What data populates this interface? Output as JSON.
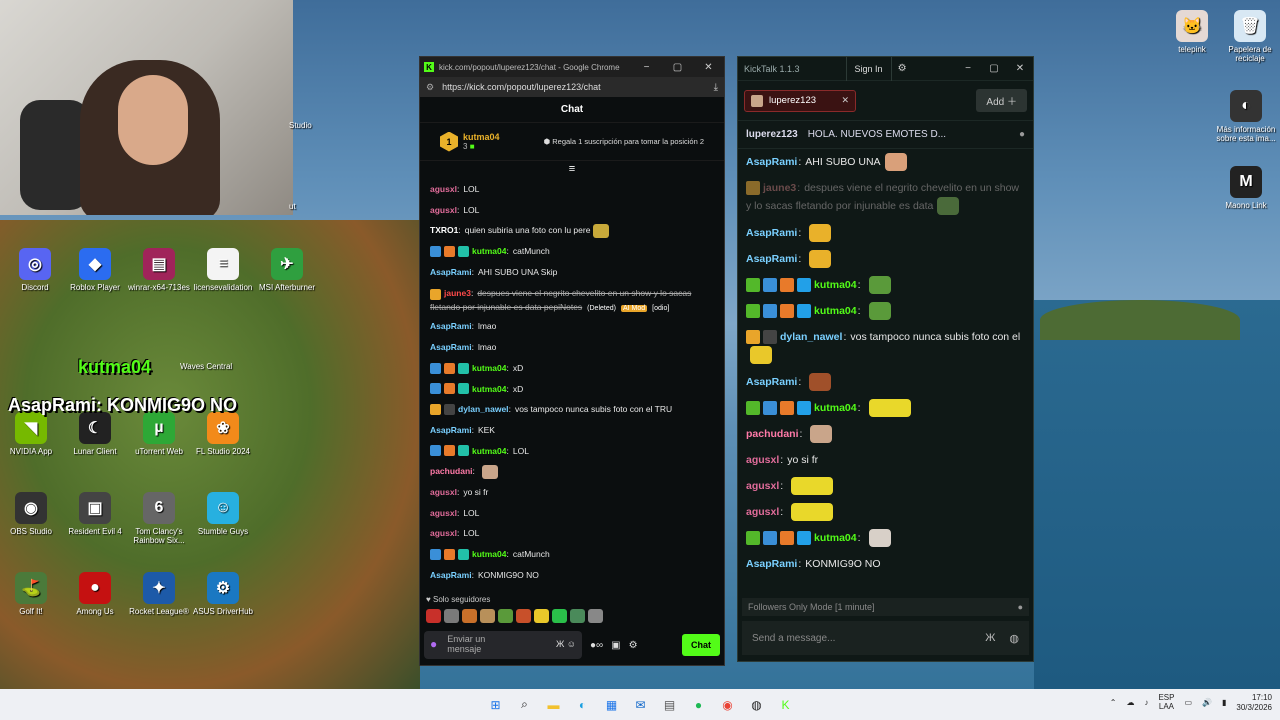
{
  "desktop": {
    "icons_left": [
      {
        "label": "Discord",
        "color": "#5865f2",
        "glyph": "◎"
      },
      {
        "label": "Roblox Player",
        "color": "#2b6cf0",
        "glyph": "◆"
      },
      {
        "label": "winrar-x64-713es",
        "color": "#a0245a",
        "glyph": "▤"
      },
      {
        "label": "licensevalidation",
        "color": "#f4f4f4",
        "glyph": "≡"
      },
      {
        "label": "MSI Afterburner",
        "color": "#2f9f3f",
        "glyph": "✈"
      },
      {
        "label": "NVIDIA App",
        "color": "#76b900",
        "glyph": "◥"
      },
      {
        "label": "Lunar Client",
        "color": "#222",
        "glyph": "☾"
      },
      {
        "label": "uTorrent Web",
        "color": "#2ea836",
        "glyph": "µ"
      },
      {
        "label": "FL Studio 2024",
        "color": "#f28a1a",
        "glyph": "❀"
      },
      {
        "label": "OBS Studio",
        "color": "#333",
        "glyph": "◉"
      },
      {
        "label": "Resident Evil 4",
        "color": "#444",
        "glyph": "▣"
      },
      {
        "label": "Tom Clancy's Rainbow Six...",
        "color": "#666",
        "glyph": "6"
      },
      {
        "label": "Stumble Guys",
        "color": "#27b0e0",
        "glyph": "☺"
      },
      {
        "label": "Golf It!",
        "color": "#4b7a3a",
        "glyph": "⛳"
      },
      {
        "label": "Among Us",
        "color": "#c51111",
        "glyph": "●"
      },
      {
        "label": "Rocket League®",
        "color": "#1d5aa8",
        "glyph": "✦"
      },
      {
        "label": "ASUS DriverHub",
        "color": "#1a78c2",
        "glyph": "⚙"
      }
    ],
    "partial_labels": {
      "studio": "Studio",
      "ut": "ut",
      "waves_central": "Waves Central"
    },
    "icons_right": [
      {
        "label": "telepink",
        "color": "#e5d9d4",
        "glyph": "🐱"
      },
      {
        "label": "Papelera de reciclaje",
        "color": "#d8e8f4",
        "glyph": "🗑"
      },
      {
        "label": "Más información sobre esta ima...",
        "color": "#333",
        "glyph": "◐"
      },
      {
        "label": "Maono Link",
        "color": "#222",
        "glyph": "M"
      }
    ]
  },
  "overlay": {
    "top_name": "kutma04",
    "bottom_user": "AsapRami",
    "bottom_msg": ": KONMIG9O NO"
  },
  "chrome": {
    "title": "kick.com/popout/luperez123/chat - Google Chrome",
    "url": "https://kick.com/popout/luperez123/chat",
    "chat_header": "Chat",
    "pinned": {
      "rank": "1",
      "user": "kutma04",
      "count": "3",
      "action": "Regala 1 suscripción para tomar la posición 2"
    },
    "messages": [
      {
        "badges": [],
        "user": "agusxl",
        "ucolor": "#e06c9a",
        "text": "LOL",
        "emote": ""
      },
      {
        "badges": [],
        "user": "agusxl",
        "ucolor": "#e06c9a",
        "text": "LOL",
        "emote": ""
      },
      {
        "badges": [],
        "user": "TXRO1",
        "ucolor": "#ffffff",
        "text": "quien subiria una foto con lu pere",
        "emote": "#c8a93a"
      },
      {
        "badges": [
          "#3a8fd8",
          "#e87a2a",
          "#22c0a8"
        ],
        "user": "kutma04",
        "ucolor": "#53fc18",
        "text": "catMunch",
        "emote": ""
      },
      {
        "badges": [],
        "user": "AsapRami",
        "ucolor": "#7ad0ff",
        "text": "AHI SUBO UNA Skip",
        "emote": ""
      },
      {
        "badges": [
          "#e9a52a"
        ],
        "user": "jaune3",
        "ucolor": "#ff4a4a",
        "text": "despues viene el negrito chevelito en un show y lo sacas fletando por injunable es data pepiNotes",
        "deleted": "(Deleted)",
        "aimod": "AI Mod",
        "odio": "[odio]",
        "tall": true
      },
      {
        "badges": [],
        "user": "AsapRami",
        "ucolor": "#7ad0ff",
        "text": "lmao",
        "emote": ""
      },
      {
        "badges": [],
        "user": "AsapRami",
        "ucolor": "#7ad0ff",
        "text": "lmao",
        "emote": ""
      },
      {
        "badges": [
          "#3a8fd8",
          "#e87a2a",
          "#22c0a8"
        ],
        "user": "kutma04",
        "ucolor": "#53fc18",
        "text": "xD",
        "emote": ""
      },
      {
        "badges": [
          "#3a8fd8",
          "#e87a2a",
          "#22c0a8"
        ],
        "user": "kutma04",
        "ucolor": "#53fc18",
        "text": "xD",
        "emote": ""
      },
      {
        "badges": [
          "#e9a52a",
          "#444"
        ],
        "user": "dylan_nawel",
        "ucolor": "#7ad0ff",
        "text": "vos tampoco nunca subis foto con el TRU",
        "emote": ""
      },
      {
        "badges": [],
        "user": "AsapRami",
        "ucolor": "#7ad0ff",
        "text": "KEK",
        "emote": ""
      },
      {
        "badges": [
          "#3a8fd8",
          "#e87a2a",
          "#22c0a8"
        ],
        "user": "kutma04",
        "ucolor": "#53fc18",
        "text": "LOL",
        "emote": ""
      },
      {
        "badges": [],
        "user": "pachudani",
        "ucolor": "#ff7aa8",
        "text": "",
        "emote": "#c9a58a"
      },
      {
        "badges": [],
        "user": "agusxl",
        "ucolor": "#e06c9a",
        "text": "yo si fr",
        "emote": ""
      },
      {
        "badges": [],
        "user": "agusxl",
        "ucolor": "#e06c9a",
        "text": "LOL",
        "emote": ""
      },
      {
        "badges": [],
        "user": "agusxl",
        "ucolor": "#e06c9a",
        "text": "LOL",
        "emote": ""
      },
      {
        "badges": [
          "#3a8fd8",
          "#e87a2a",
          "#22c0a8"
        ],
        "user": "kutma04",
        "ucolor": "#53fc18",
        "text": "catMunch",
        "emote": ""
      },
      {
        "badges": [],
        "user": "AsapRami",
        "ucolor": "#7ad0ff",
        "text": "KONMIG9O NO",
        "emote": ""
      }
    ],
    "followers_only": "Solo seguidores",
    "input_placeholder": "Enviar un mensaje",
    "send_label": "Chat"
  },
  "kicktalk": {
    "title": "KickTalk 1.1.3",
    "sign_in": "Sign In",
    "tab_label": "luperez123",
    "add_label": "Add",
    "pinned_user": "luperez123",
    "pinned_text": "HOLA. NUEVOS EMOTES D...",
    "messages": [
      {
        "badges": [],
        "user": "AsapRami",
        "ucolor": "#7ad0ff",
        "text": "AHI SUBO UNA",
        "emote": "#d9a07a"
      },
      {
        "badges": [
          "#8a6a2a"
        ],
        "user": "jaune3",
        "ucolor": "#6a4a4a",
        "text": "despues viene el negrito chevelito en un show y lo sacas fletando por injunable es data",
        "emote": "#4a6a3a",
        "tall": true,
        "dim": true
      },
      {
        "badges": [],
        "user": "AsapRami",
        "ucolor": "#7ad0ff",
        "text": "",
        "emote": "#e9b12a"
      },
      {
        "badges": [],
        "user": "AsapRami",
        "ucolor": "#7ad0ff",
        "text": "",
        "emote": "#e9b12a"
      },
      {
        "badges": [
          "#53b82a",
          "#3a8fd8",
          "#e87a2a",
          "#22a0e8"
        ],
        "user": "kutma04",
        "ucolor": "#53fc18",
        "text": "",
        "emote": "#5a9a3a"
      },
      {
        "badges": [
          "#53b82a",
          "#3a8fd8",
          "#e87a2a",
          "#22a0e8"
        ],
        "user": "kutma04",
        "ucolor": "#53fc18",
        "text": "",
        "emote": "#5a9a3a"
      },
      {
        "badges": [
          "#e9a52a",
          "#444"
        ],
        "user": "dylan_nawel",
        "ucolor": "#7ad0ff",
        "text": "vos tampoco nunca subis foto con el",
        "emote": "#e9c82a",
        "tall": true
      },
      {
        "badges": [],
        "user": "AsapRami",
        "ucolor": "#7ad0ff",
        "text": "",
        "emote": "#a0502a"
      },
      {
        "badges": [
          "#53b82a",
          "#3a8fd8",
          "#e87a2a",
          "#22a0e8"
        ],
        "user": "kutma04",
        "ucolor": "#53fc18",
        "text": "",
        "emote": "#e9d82a",
        "wide": true
      },
      {
        "badges": [],
        "user": "pachudani",
        "ucolor": "#ff7aa8",
        "text": "",
        "emote": "#c9a58a"
      },
      {
        "badges": [],
        "user": "agusxl",
        "ucolor": "#e06c9a",
        "text": "yo si fr",
        "emote": ""
      },
      {
        "badges": [],
        "user": "agusxl",
        "ucolor": "#e06c9a",
        "text": "",
        "emote": "#e9d82a",
        "wide": true
      },
      {
        "badges": [],
        "user": "agusxl",
        "ucolor": "#e06c9a",
        "text": "",
        "emote": "#e9d82a",
        "wide": true
      },
      {
        "badges": [
          "#53b82a",
          "#3a8fd8",
          "#e87a2a",
          "#22a0e8"
        ],
        "user": "kutma04",
        "ucolor": "#53fc18",
        "text": "",
        "emote": "#d8d0c8"
      },
      {
        "badges": [],
        "user": "AsapRami",
        "ucolor": "#7ad0ff",
        "text": "KONMIG9O NO",
        "emote": ""
      }
    ],
    "followers_mode": "Followers Only Mode [1 minute]",
    "input_placeholder": "Send a message..."
  },
  "taskbar": {
    "apps": [
      {
        "name": "start-button",
        "glyph": "⊞",
        "color": "#1a73e8"
      },
      {
        "name": "search-icon",
        "glyph": "⌕",
        "color": "#222"
      },
      {
        "name": "file-explorer-icon",
        "glyph": "▬",
        "color": "#f2c12e"
      },
      {
        "name": "edge-icon",
        "glyph": "◐",
        "color": "#1a9fe0"
      },
      {
        "name": "store-icon",
        "glyph": "▦",
        "color": "#1a73e8"
      },
      {
        "name": "outlook-icon",
        "glyph": "✉",
        "color": "#0a64c8"
      },
      {
        "name": "app-icon",
        "glyph": "▤",
        "color": "#555"
      },
      {
        "name": "spotify-icon",
        "glyph": "●",
        "color": "#1db954"
      },
      {
        "name": "chrome-icon",
        "glyph": "◉",
        "color": "#e94235"
      },
      {
        "name": "app2-icon",
        "glyph": "◍",
        "color": "#222"
      },
      {
        "name": "kick-icon",
        "glyph": "K",
        "color": "#53fc18"
      }
    ],
    "lang_top": "ESP",
    "lang_bottom": "LAA",
    "time": "17:10",
    "date": "30/3/2026"
  }
}
